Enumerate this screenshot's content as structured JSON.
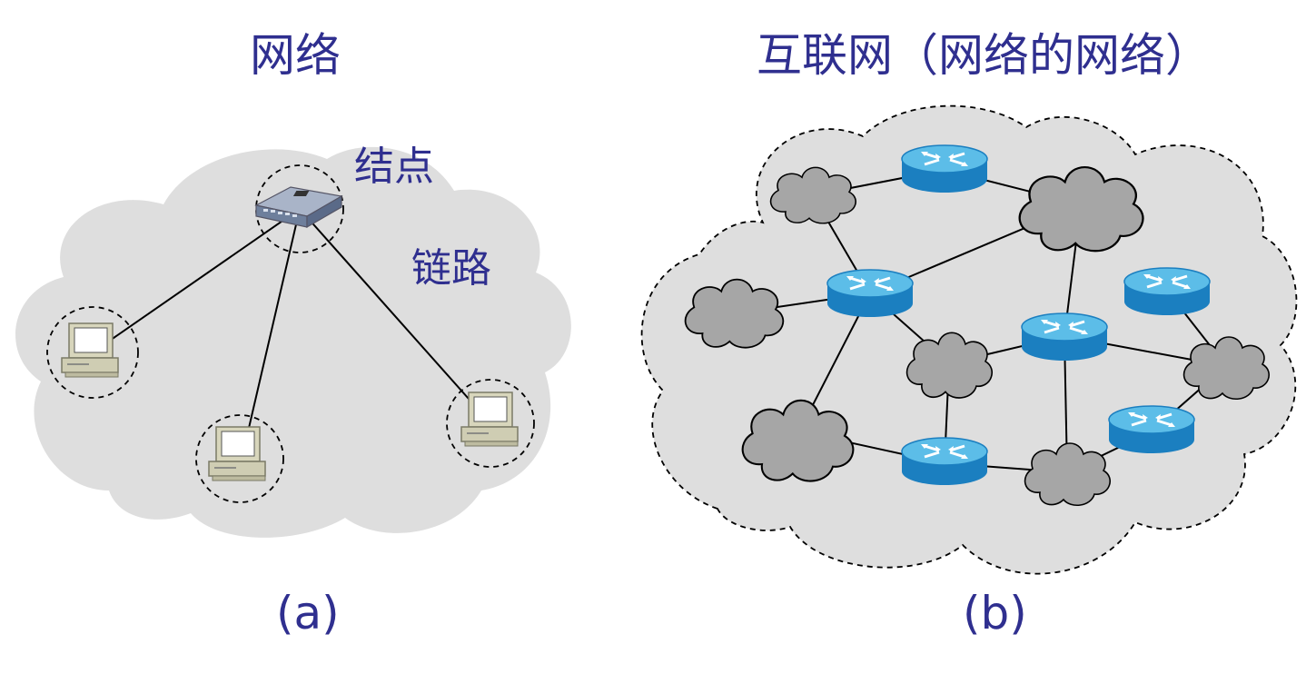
{
  "panel_a": {
    "title": "网络",
    "node_label": "结点",
    "link_label": "链路",
    "caption": "(a)"
  },
  "panel_b": {
    "title": "互联网（网络的网络）",
    "caption": "(b)"
  },
  "colors": {
    "text": "#2f2f8f",
    "cloud_fill": "#dedede",
    "small_cloud_fill": "#a6a6a6",
    "router_blue": "#1f8fd0",
    "router_top": "#63bfe8",
    "link": "#000000"
  },
  "icons": {
    "panel_a_hub": "switch-hub-icon",
    "panel_a_hosts": "desktop-computer-icon",
    "panel_b_nodes": "router-icon"
  }
}
